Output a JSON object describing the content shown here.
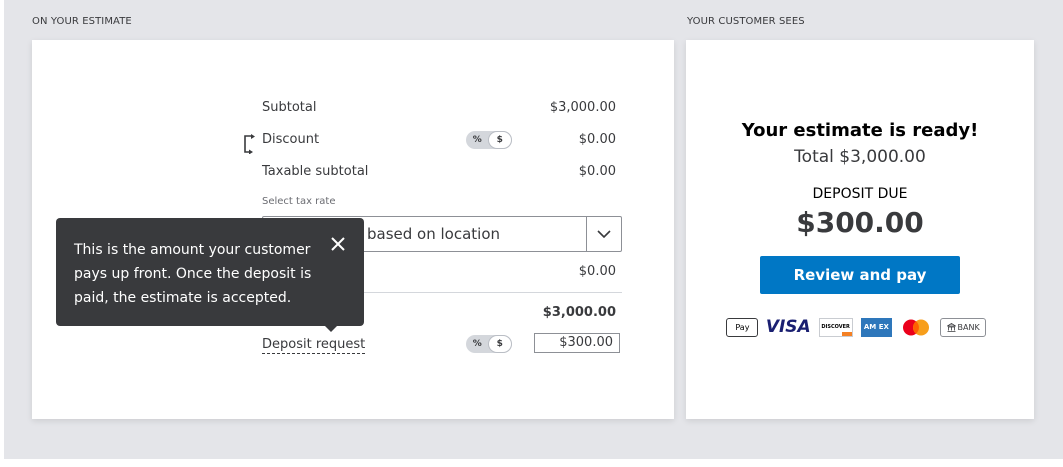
{
  "labels": {
    "left_section": "ON YOUR ESTIMATE",
    "right_section": "YOUR CUSTOMER SEES"
  },
  "estimate": {
    "subtotal_label": "Subtotal",
    "subtotal_value": "$3,000.00",
    "discount_label": "Discount",
    "discount_value": "$0.00",
    "taxable_label": "Taxable subtotal",
    "taxable_value": "$0.00",
    "tax_rate_label": "Select tax rate",
    "tax_rate_value": "based on location",
    "tax_value": "$0.00",
    "total_value": "$3,000.00",
    "deposit_label": "Deposit request",
    "deposit_value": "$300.00",
    "toggle_percent": "%",
    "toggle_dollar": "$"
  },
  "tooltip": {
    "text": "This is the amount your customer pays up front. Once the deposit is paid, the estimate is accepted."
  },
  "customer": {
    "heading": "Your estimate is ready!",
    "total": "Total $3,000.00",
    "deposit_due_label": "DEPOSIT DUE",
    "deposit_due_value": "$300.00",
    "review_button": "Review and pay",
    "payment_methods": {
      "apple_pay": "Pay",
      "visa": "VISA",
      "discover": "DISCOVER",
      "amex": "AM EX",
      "mastercard": "mastercard-icon",
      "bank": "BANK"
    }
  },
  "colors": {
    "accent_blue": "#0077c5",
    "tooltip_bg": "#393a3d",
    "background": "#e4e5e9"
  }
}
